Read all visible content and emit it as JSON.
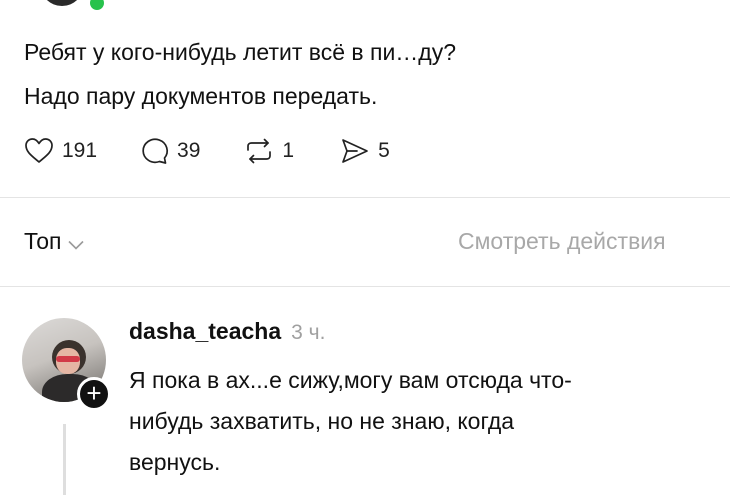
{
  "post": {
    "text_line1": "Ребят у кого-нибудь летит всё в пи…ду?",
    "text_line2": "Надо пару документов передать."
  },
  "actions": {
    "likes": "191",
    "comments": "39",
    "reposts": "1",
    "shares": "5"
  },
  "replies_header": {
    "sort_label": "Топ",
    "view_activity": "Смотреть действия"
  },
  "comment": {
    "username": "dasha_teacha",
    "time": "3 ч.",
    "text_line1": "Я пока в ах...е сижу,могу вам отсюда что-",
    "text_line2": "нибудь захватить, но не знаю, когда",
    "text_line3": "вернусь."
  },
  "colors": {
    "online": "#27c24c",
    "muted": "#a8a8a8",
    "text": "#111111"
  }
}
